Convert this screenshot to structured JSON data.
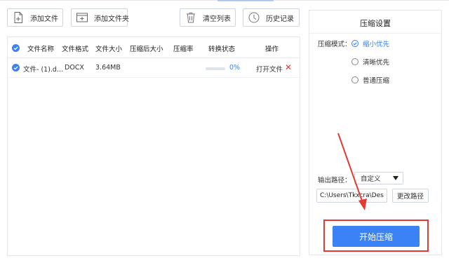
{
  "toolbar": {
    "add_file": "添加文件",
    "add_folder": "添加文件夹",
    "clear_list": "清空列表",
    "history": "历史记录"
  },
  "table": {
    "headers": [
      "文件名称",
      "文件格式",
      "文件大小",
      "压缩后大小",
      "压缩率",
      "转换状态",
      "操作"
    ],
    "rows": [
      {
        "name": "文件- (1).d...",
        "format": "DOCX",
        "size": "3.64MB",
        "compressed_size": "",
        "ratio": "",
        "progress_pct": "0%",
        "progress_value": 0,
        "action": "打开文件",
        "delete": "✕"
      }
    ]
  },
  "settings": {
    "title": "压缩设置",
    "mode_label": "压缩模式：",
    "modes": [
      {
        "label": "缩小优先",
        "selected": true
      },
      {
        "label": "清晰优先",
        "selected": false
      },
      {
        "label": "普通压缩",
        "selected": false
      }
    ],
    "output_label": "输出路径：",
    "output_option": "自定义",
    "output_path": "C:\\Users\\Tkxcra\\Desktop",
    "change_path": "更改路径",
    "start": "开始压缩"
  },
  "colors": {
    "accent": "#3b82f6",
    "highlight": "#e53935"
  }
}
